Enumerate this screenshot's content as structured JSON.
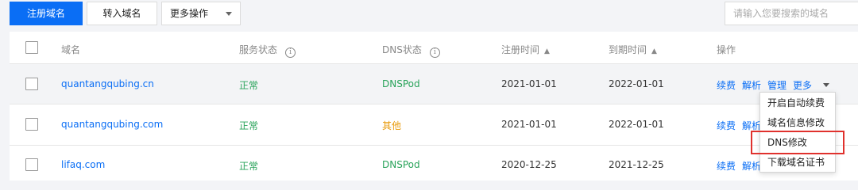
{
  "toolbar": {
    "register_label": "注册域名",
    "transfer_label": "转入域名",
    "more_ops_label": "更多操作",
    "search_placeholder": "请输入您要搜索的域名"
  },
  "table": {
    "headers": {
      "domain": "域名",
      "service_status": "服务状态",
      "dns_status": "DNS状态",
      "reg_time": "注册时间",
      "expire_time": "到期时间",
      "actions": "操作"
    },
    "rows": [
      {
        "domain": "quantangqubing.cn",
        "service_status": "正常",
        "dns_status": "DNSPod",
        "reg_time": "2021-01-01",
        "expire_time": "2022-01-01"
      },
      {
        "domain": "quantangqubing.com",
        "service_status": "正常",
        "dns_status": "其他",
        "reg_time": "2021-01-01",
        "expire_time": "2022-01-01"
      },
      {
        "domain": "lifaq.com",
        "service_status": "正常",
        "dns_status": "DNSPod",
        "reg_time": "2020-12-25",
        "expire_time": "2021-12-25"
      }
    ],
    "actions": {
      "renew": "续费",
      "resolve": "解析",
      "manage": "管理",
      "more": "更多",
      "resolve_truncated": "解析"
    }
  },
  "dropdown": {
    "items": [
      "开启自动续费",
      "域名信息修改",
      "DNS修改",
      "下载域名证书"
    ]
  },
  "colors": {
    "primary": "#0a6ef5",
    "status_ok": "#29a35a",
    "status_other": "#e89a0a",
    "highlight": "#e0312d"
  }
}
